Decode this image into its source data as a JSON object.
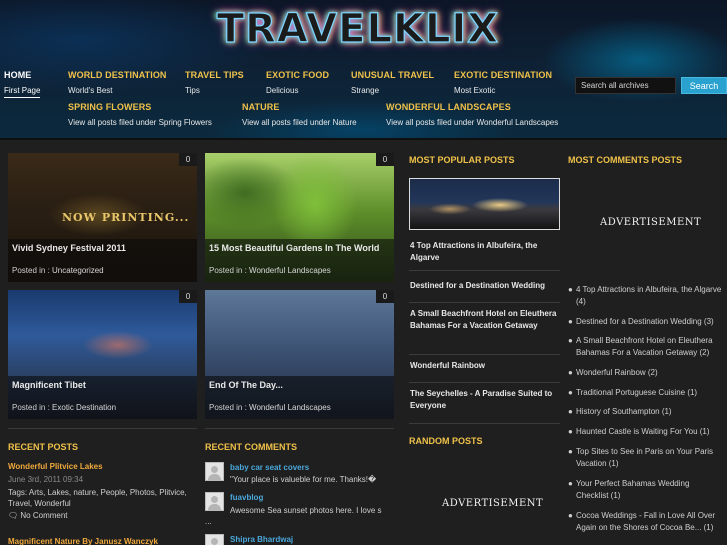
{
  "site": {
    "logo": "TRAVELKLIX"
  },
  "nav": {
    "row1": [
      {
        "title": "HOME",
        "sub": "First Page"
      },
      {
        "title": "WORLD DESTINATION",
        "sub": "World's Best"
      },
      {
        "title": "TRAVEL TIPS",
        "sub": "Tips"
      },
      {
        "title": "EXOTIC FOOD",
        "sub": "Delicious"
      },
      {
        "title": "UNUSUAL TRAVEL",
        "sub": "Strange"
      },
      {
        "title": "EXOTIC DESTINATION",
        "sub": "Most Exotic"
      }
    ],
    "row2": [
      {
        "title": "SPRING FLOWERS",
        "sub": "View all posts filed under Spring Flowers"
      },
      {
        "title": "NATURE",
        "sub": "View all posts filed under Nature"
      },
      {
        "title": "WONDERFUL LANDSCAPES",
        "sub": "View all posts filed under Wonderful Landscapes"
      }
    ]
  },
  "search": {
    "placeholder": "Search all archives",
    "button": "Search"
  },
  "featured": [
    {
      "title": "Vivid Sydney Festival 2011",
      "meta_prefix": "Posted in : ",
      "category": "Uncategorized",
      "comments": "0",
      "banner": "NOW PRINTING..."
    },
    {
      "title": "15 Most Beautiful Gardens In The World",
      "meta_prefix": "Posted in : ",
      "category": "Wonderful Landscapes",
      "comments": "0"
    },
    {
      "title": "Magnificent Tibet",
      "meta_prefix": "Posted in : ",
      "category": "Exotic Destination",
      "comments": "0"
    },
    {
      "title": "End Of The Day...",
      "meta_prefix": "Posted in : ",
      "category": "Wonderful Landscapes",
      "comments": "0"
    }
  ],
  "popular": {
    "heading": "MOST POPULAR POSTS",
    "items": [
      "4 Top Attractions in Albufeira, the Algarve",
      "Destined for a Destination Wedding",
      "A Small Beachfront Hotel on Eleuthera Bahamas For a Vacation Getaway",
      "Wonderful Rainbow",
      "The Seychelles - A Paradise Suited to Everyone"
    ]
  },
  "random": {
    "heading": "RANDOM POSTS"
  },
  "advertisement": "ADVERTISEMENT",
  "most_comments": {
    "heading": "MOST COMMENTS POSTS",
    "items": [
      "4 Top Attractions in Albufeira, the Algarve (4)",
      "Destined for a Destination Wedding (3)",
      "A Small Beachfront Hotel on Eleuthera Bahamas For a Vacation Getaway (2)",
      "Wonderful Rainbow (2)",
      "Traditional Portuguese Cuisine (1)",
      "History of Southampton (1)",
      "Haunted Castle is Waiting For You (1)",
      "Top Sites to See in Paris on Your Paris Vacation (1)",
      "Your Perfect Bahamas Wedding Checklist (1)",
      "Cocoa Weddings - Fall in Love All Over Again on the Shores of Cocoa Be... (1)"
    ]
  },
  "recent_posts": {
    "heading": "RECENT POSTS",
    "post": {
      "title": "Wonderful Plitvice Lakes",
      "date": "June 3rd, 2011 09:34",
      "tags": "Tags: Arts, Lakes, nature, People, Photos, Plitvice, Travel, Wonderful",
      "comment": "No Comment"
    },
    "next_title": "Magnificent Nature By Janusz Wanczyk"
  },
  "recent_comments": {
    "heading": "RECENT COMMENTS",
    "items": [
      {
        "author": "baby car seat covers",
        "text": "\"Your place is valueble for me. Thanks!�"
      },
      {
        "author": "fuavblog",
        "text": "Awesome Sea sunset photos here. I love s"
      },
      {
        "author": "Shipra Bhardwaj",
        "text": ""
      }
    ],
    "ellipsis": "..."
  },
  "colors": {
    "accent": "#f0c24a",
    "link": "#4aa8dc",
    "search_button": "#2aa2cf",
    "background": "#1f1f1f"
  }
}
